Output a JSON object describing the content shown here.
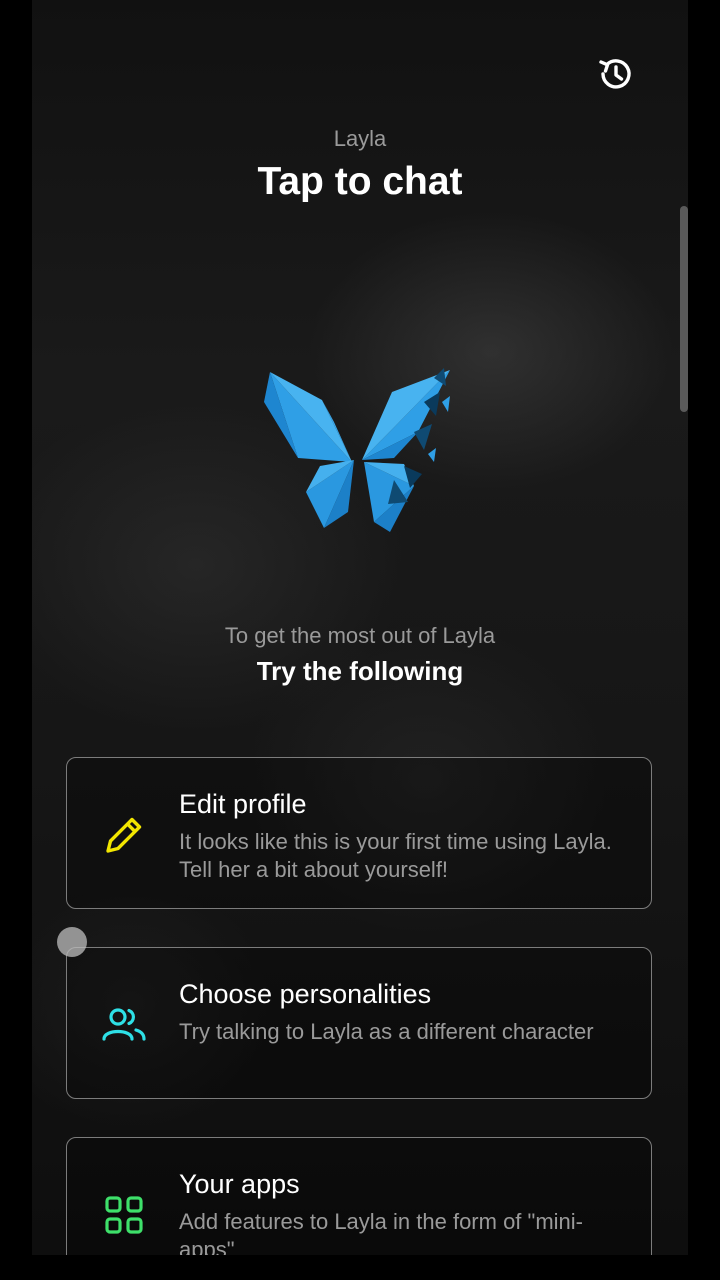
{
  "header": {
    "subtitle": "Layla",
    "title": "Tap to chat"
  },
  "icons": {
    "history": "history-icon",
    "logo": "butterfly-logo"
  },
  "hint": {
    "subtitle": "To get the most out of Layla",
    "title": "Try the following"
  },
  "cards": [
    {
      "icon": "pencil-icon",
      "icon_color": "#f2e600",
      "title": "Edit profile",
      "description": "It looks like this is your first time using Layla. Tell her a bit about yourself!"
    },
    {
      "icon": "users-icon",
      "icon_color": "#2ee0e6",
      "title": "Choose personalities",
      "description": "Try talking to Layla as a different character"
    },
    {
      "icon": "apps-grid-icon",
      "icon_color": "#3ee06a",
      "title": "Your apps",
      "description": "Add features to Layla in the form of \"mini-apps\""
    }
  ],
  "colors": {
    "logo_blue": "#2c9ee8",
    "text_primary": "#ffffff",
    "text_secondary": "#9a9a9a"
  }
}
